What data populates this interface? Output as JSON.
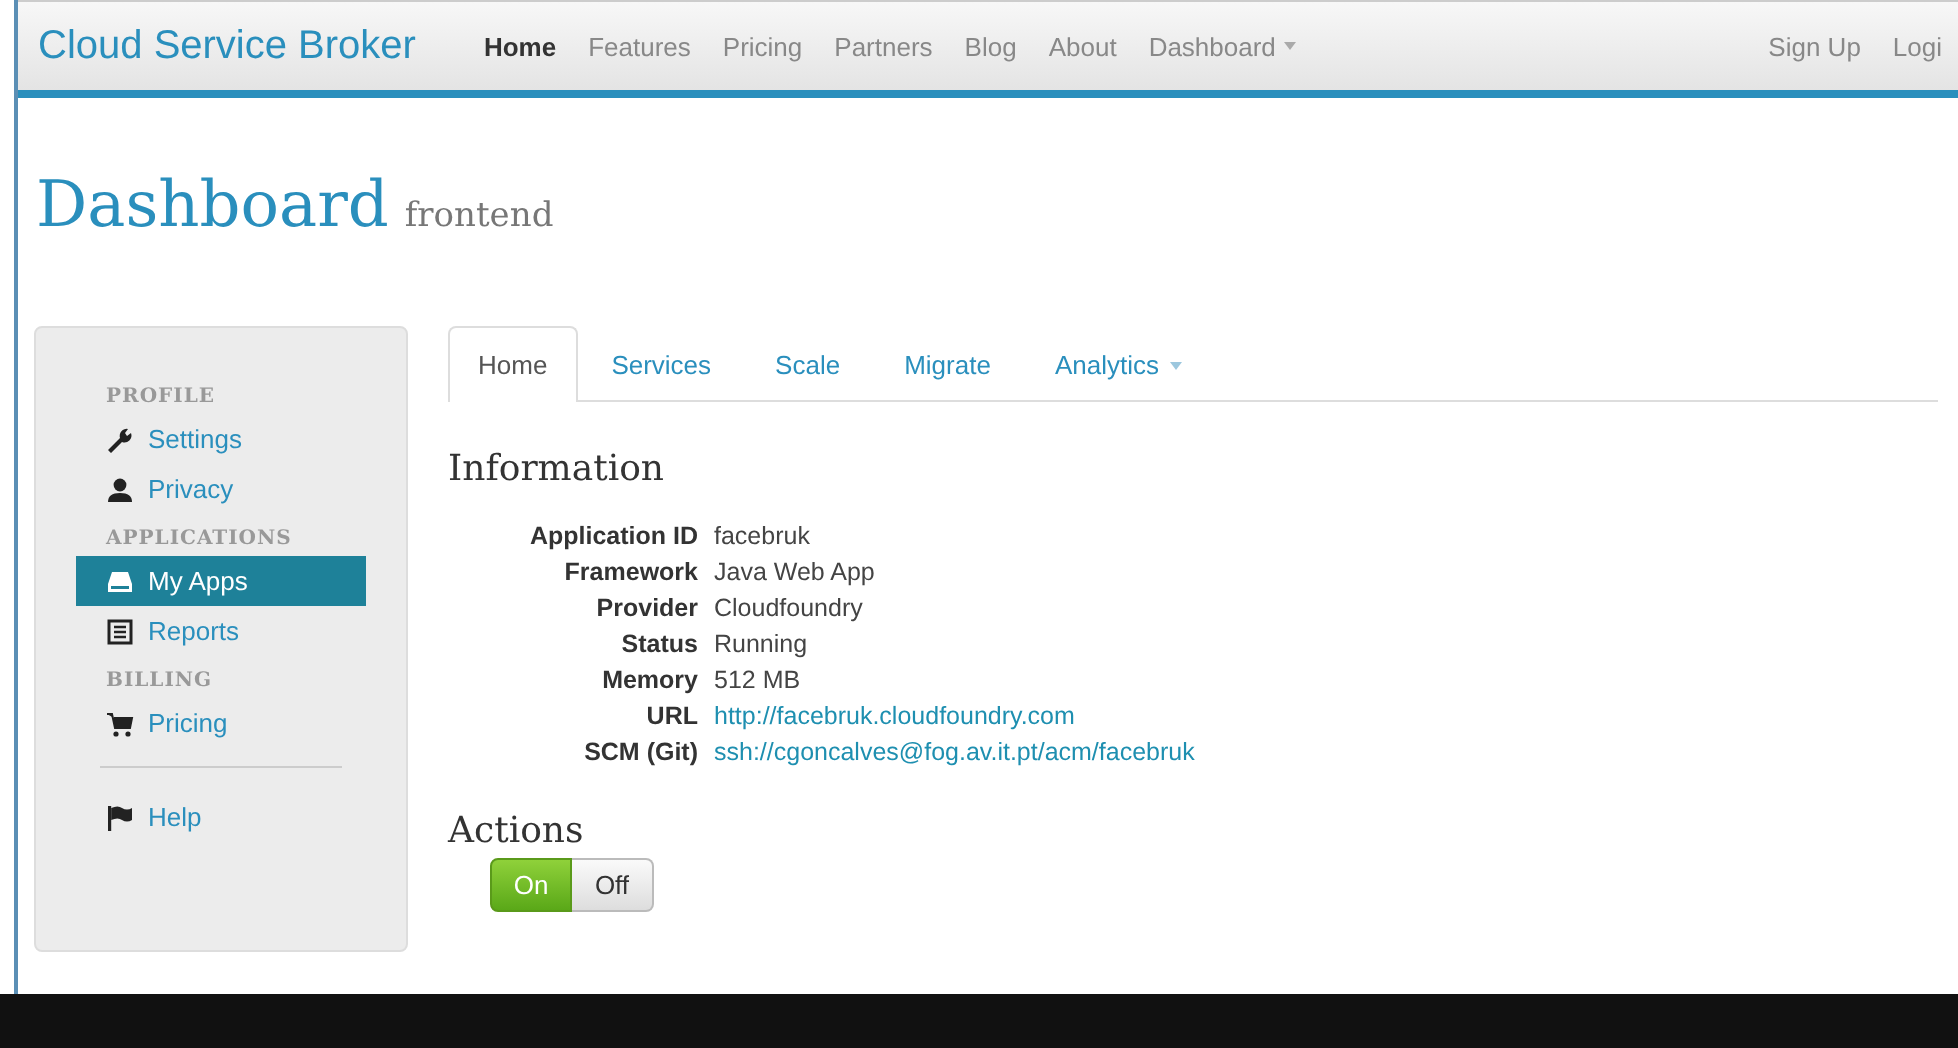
{
  "navbar": {
    "brand": "Cloud Service Broker",
    "items": [
      {
        "label": "Home",
        "selected": true
      },
      {
        "label": "Features",
        "selected": false
      },
      {
        "label": "Pricing",
        "selected": false
      },
      {
        "label": "Partners",
        "selected": false
      },
      {
        "label": "Blog",
        "selected": false
      },
      {
        "label": "About",
        "selected": false
      },
      {
        "label": "Dashboard",
        "selected": false,
        "dropdown": true
      }
    ],
    "right_items": [
      {
        "label": "Sign Up"
      },
      {
        "label": "Logi"
      }
    ]
  },
  "page_header": {
    "title": "Dashboard",
    "subtitle": "frontend"
  },
  "sidebar": {
    "sections": [
      {
        "header": "PROFILE",
        "items": [
          {
            "label": "Settings",
            "selected": false
          },
          {
            "label": "Privacy",
            "selected": false
          }
        ]
      },
      {
        "header": "APPLICATIONS",
        "items": [
          {
            "label": "My Apps",
            "selected": true
          },
          {
            "label": "Reports",
            "selected": false
          }
        ]
      },
      {
        "header": "BILLING",
        "items": [
          {
            "label": "Pricing",
            "selected": false
          }
        ]
      },
      {
        "items": [
          {
            "label": "Help",
            "selected": false
          }
        ]
      }
    ]
  },
  "tabs": [
    {
      "label": "Home",
      "selected": true
    },
    {
      "label": "Services",
      "selected": false
    },
    {
      "label": "Scale",
      "selected": false
    },
    {
      "label": "Migrate",
      "selected": false
    },
    {
      "label": "Analytics",
      "selected": false,
      "dropdown": true
    }
  ],
  "information": {
    "heading": "Information",
    "fields": [
      {
        "label": "Application ID",
        "value": "facebruk",
        "kind": "text"
      },
      {
        "label": "Framework",
        "value": "Java Web App",
        "kind": "text"
      },
      {
        "label": "Provider",
        "value": "Cloudfoundry",
        "kind": "text"
      },
      {
        "label": "Status",
        "value": "Running",
        "kind": "text"
      },
      {
        "label": "Memory",
        "value": "512 MB",
        "kind": "text"
      },
      {
        "label": "URL",
        "value": "http://facebruk.cloudfoundry.com",
        "kind": "link"
      },
      {
        "label": "SCM (Git)",
        "value": "ssh://cgoncalves@fog.av.it.pt/acm/facebruk",
        "kind": "link"
      }
    ]
  },
  "actions": {
    "heading": "Actions",
    "toggle": [
      {
        "label": "On",
        "selected": true
      },
      {
        "label": "Off",
        "selected": false
      }
    ]
  }
}
